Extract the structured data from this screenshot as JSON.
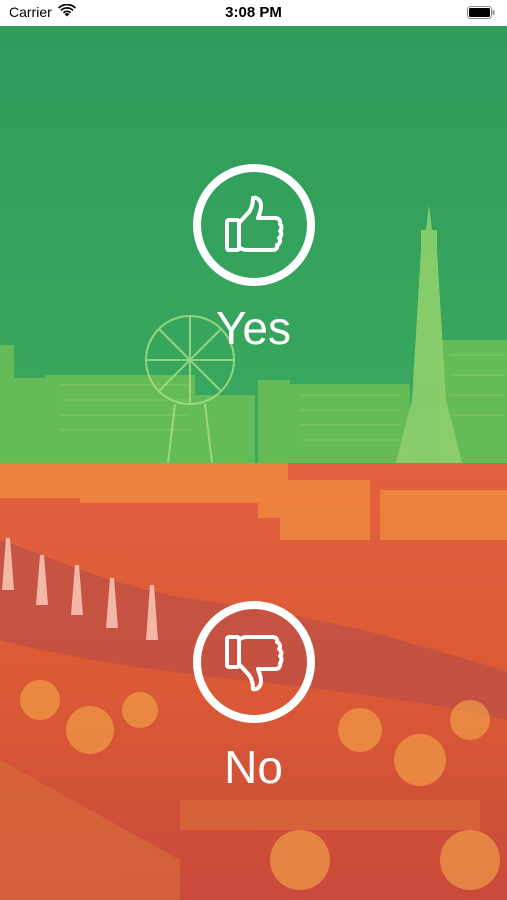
{
  "status_bar": {
    "carrier": "Carrier",
    "time": "3:08 PM"
  },
  "choices": {
    "yes": {
      "label": "Yes",
      "color": "#2ea45c",
      "icon": "thumbs-up-icon"
    },
    "no": {
      "label": "No",
      "color": "#e35a3c",
      "icon": "thumbs-down-icon"
    }
  },
  "background_image": "city-skyline-at-night"
}
